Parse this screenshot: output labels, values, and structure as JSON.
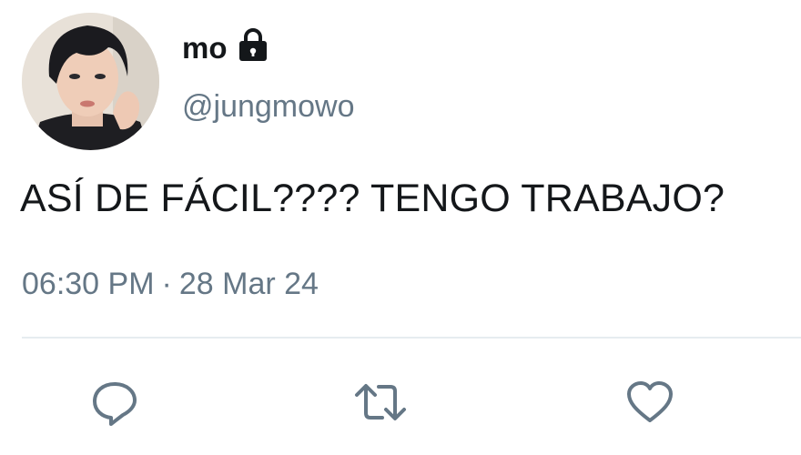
{
  "tweet": {
    "display_name": "mo",
    "handle": "@jungmowo",
    "text": "ASÍ DE FÁCIL???? TENGO TRABAJO?",
    "time": "06:30 PM",
    "separator": "·",
    "date": "28 Mar 24",
    "protected_icon": "lock-icon",
    "avatar": "profile-photo"
  },
  "actions": [
    {
      "name": "reply",
      "icon": "reply-icon"
    },
    {
      "name": "retweet",
      "icon": "retweet-icon"
    },
    {
      "name": "like",
      "icon": "heart-icon"
    }
  ],
  "colors": {
    "text": "#14171a",
    "secondary": "#657786",
    "icon": "#657786",
    "divider": "#e6ecf0"
  }
}
